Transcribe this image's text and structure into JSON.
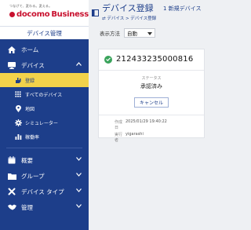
{
  "brand": {
    "tagline": "つなげて、変わる。変える。",
    "name_docomo": "docomo",
    "name_business": "Business",
    "section": "デバイス管理"
  },
  "sidebar": {
    "items": [
      {
        "label": "ホーム",
        "icon": "home-icon"
      },
      {
        "label": "デバイス",
        "icon": "device-icon",
        "expanded": true
      },
      {
        "label": "概要",
        "icon": "calendar-icon",
        "expanded": false
      },
      {
        "label": "グループ",
        "icon": "folder-icon",
        "expanded": false
      },
      {
        "label": "デバイス タイプ",
        "icon": "wrench-icon",
        "expanded": false
      },
      {
        "label": "管理",
        "icon": "handshake-icon",
        "expanded": false
      }
    ],
    "device_sub": [
      {
        "label": "登録",
        "icon": "hand-icon",
        "active": true
      },
      {
        "label": "すべてのデバイス",
        "icon": "grid-icon",
        "active": false
      },
      {
        "label": "地図",
        "icon": "pin-icon",
        "active": false
      },
      {
        "label": "シミュレーター",
        "icon": "gear-icon",
        "active": false
      },
      {
        "label": "稼働率",
        "icon": "bar-chart-icon",
        "active": false
      }
    ]
  },
  "header": {
    "title": "デバイス登録",
    "subtitle": "1 新規デバイス",
    "breadcrumb": "⇄ デバイス > デバイス登録"
  },
  "view": {
    "label": "表示方法",
    "selected": "自動"
  },
  "card": {
    "device_id": "212433235000816",
    "status_label": "ステータス",
    "status_value": "承認済み",
    "cancel_label": "キャンセル",
    "created_key": "作成日",
    "created_value": "2025/01/29 19:40:22",
    "executor_key": "実行者",
    "executor_value": "yigarashi"
  },
  "colors": {
    "sidebar": "#1d3e8a",
    "active": "#f2d24a",
    "brand": "#c8102e",
    "ok": "#3aa35b"
  }
}
